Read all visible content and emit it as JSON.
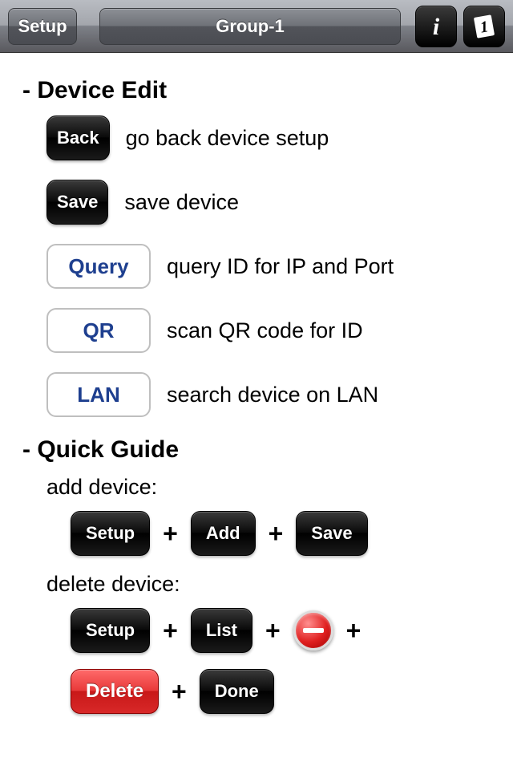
{
  "toolbar": {
    "setup_label": "Setup",
    "title": "Group-1",
    "info_badge": "1"
  },
  "sections": {
    "device_edit_title": "- Device Edit",
    "quick_guide_title": "- Quick Guide"
  },
  "device_edit": {
    "back_btn": "Back",
    "back_desc": "go back device setup",
    "save_btn": "Save",
    "save_desc": "save device",
    "query_btn": "Query",
    "query_desc": "query ID for IP and Port",
    "qr_btn": "QR",
    "qr_desc": "scan QR code for ID",
    "lan_btn": "LAN",
    "lan_desc": "search device on LAN"
  },
  "quick_guide": {
    "add_label": "add device:",
    "delete_label": "delete device:",
    "plus": "+",
    "add_steps": {
      "setup": "Setup",
      "add": "Add",
      "save": "Save"
    },
    "delete_steps": {
      "setup": "Setup",
      "list": "List",
      "delete": "Delete",
      "done": "Done"
    }
  }
}
